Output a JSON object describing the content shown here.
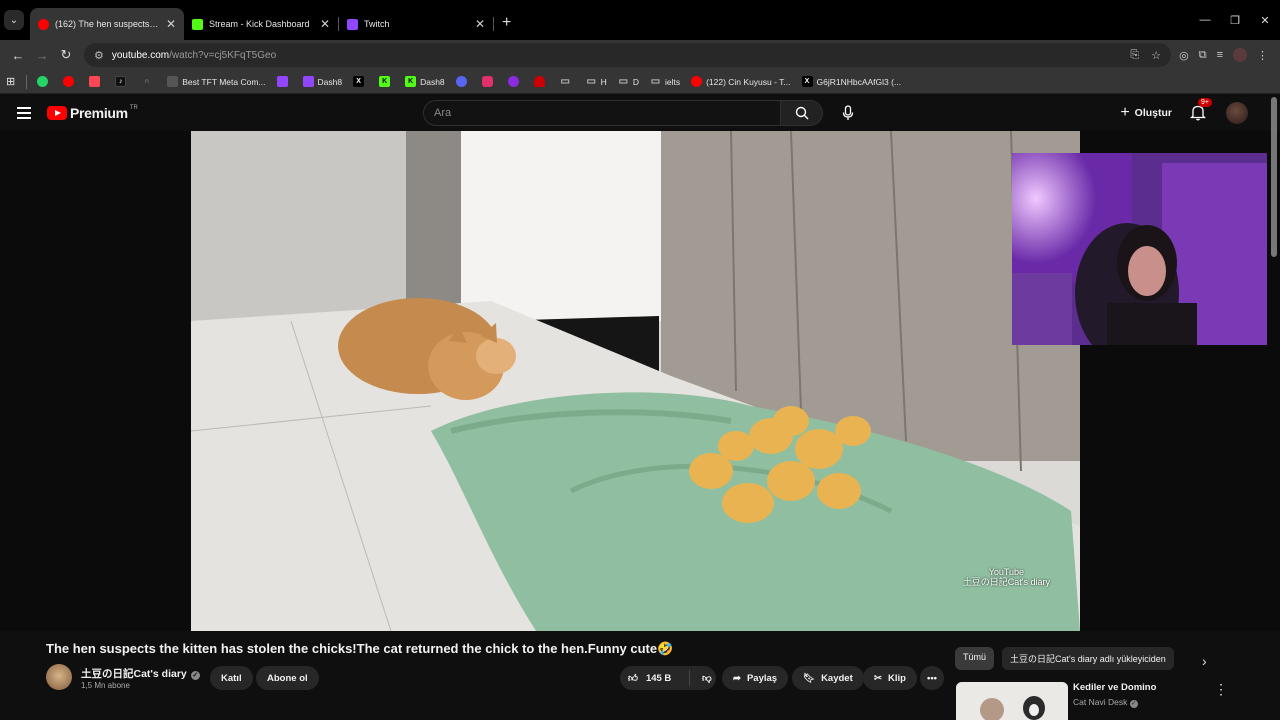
{
  "browser": {
    "tabs": [
      {
        "title": "(162) The hen suspects the kitten",
        "color": "#ff0000",
        "active": true
      },
      {
        "title": "Stream - Kick Dashboard",
        "color": "#53fc18",
        "active": false
      },
      {
        "title": "Twitch",
        "color": "#9146ff",
        "active": false
      }
    ],
    "url_host": "youtube.com",
    "url_path": "/watch?v=cj5KFqT5Geo",
    "bookmarks": [
      {
        "label": "",
        "color": "#25d366"
      },
      {
        "label": "",
        "color": "#ff0000"
      },
      {
        "label": "",
        "color": "#ff4655"
      },
      {
        "label": "",
        "color": "#111111"
      },
      {
        "label": "",
        "color": "#444444"
      },
      {
        "label": "Best TFT Meta Com...",
        "color": "#555555"
      },
      {
        "label": "",
        "color": "#9146ff"
      },
      {
        "label": "Dash8",
        "color": "#9146ff"
      },
      {
        "label": "",
        "color": "#000000"
      },
      {
        "label": "",
        "color": "#53fc18"
      },
      {
        "label": "Dash8",
        "color": "#53fc18"
      },
      {
        "label": "",
        "color": "#5865f2"
      },
      {
        "label": "",
        "color": "#e1306c"
      },
      {
        "label": "",
        "color": "#8a2be2"
      },
      {
        "label": "",
        "color": "#cc0000"
      },
      {
        "label": "",
        "color": "#888888"
      },
      {
        "label": "H",
        "color": "#888888"
      },
      {
        "label": "D",
        "color": "#888888"
      },
      {
        "label": "ielts",
        "color": "#888888"
      },
      {
        "label": "(122) Cin Kuyusu - T...",
        "color": "#ff0000"
      },
      {
        "label": "G6jR1NHbcAAfGl3 (...",
        "color": "#000000"
      }
    ]
  },
  "youtube": {
    "logo_text": "Premium",
    "country_code": "TR",
    "search_placeholder": "Ara",
    "create_label": "Oluştur",
    "notif_badge": "9+"
  },
  "video": {
    "title": "The hen suspects the kitten has stolen the chicks!The cat returned the chick to the hen.Funny cute🤣",
    "watermark_line1": "YouTube",
    "watermark_line2": "土豆の日記Cat's diary"
  },
  "channel": {
    "name": "土豆の日記Cat's diary",
    "subscribers": "1,5 Mn abone",
    "join_label": "Katıl",
    "subscribe_label": "Abone ol"
  },
  "actions": {
    "likes": "145 B",
    "share_label": "Paylaş",
    "save_label": "Kaydet",
    "clip_label": "Klip"
  },
  "sidebar": {
    "chips": [
      "Tümü",
      "土豆の日記Cat's diary adlı yükleyiciden"
    ],
    "recommended": {
      "title": "Kediler ve Domino",
      "channel": "Cat Navi Desk"
    }
  }
}
